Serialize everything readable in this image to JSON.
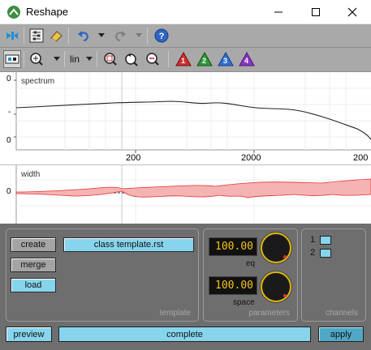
{
  "window": {
    "title": "Reshape"
  },
  "toolbar1": {
    "icons": [
      "pin-icon",
      "settings-icon",
      "eraser-icon",
      "undo-icon",
      "redo-icon",
      "help-icon"
    ]
  },
  "toolbar2": {
    "scale_value": "lin",
    "marker_labels": [
      "1",
      "2",
      "3",
      "4"
    ],
    "marker_colors": [
      "#d32f2f",
      "#2e9a3a",
      "#2f6fd6",
      "#8a35c8"
    ]
  },
  "spectrum": {
    "label": "spectrum",
    "y_ticks": [
      "0",
      "-",
      "0"
    ],
    "x_ticks": [
      "200",
      "2000",
      "200"
    ]
  },
  "width": {
    "label": "width",
    "y_tick": "0"
  },
  "template": {
    "group_label": "template",
    "buttons": {
      "create": "create",
      "merge": "merge",
      "load": "load"
    },
    "file_name": "class template.rst"
  },
  "parameters": {
    "group_label": "parameters",
    "eq": {
      "name": "eq",
      "value": "100.00"
    },
    "space": {
      "name": "space",
      "value": "100.00"
    }
  },
  "channels": {
    "group_label": "channels",
    "items": [
      "1",
      "2"
    ]
  },
  "footer": {
    "preview": "preview",
    "status": "complete",
    "apply": "apply"
  },
  "colors": {
    "toolbar": "#a9a9a9",
    "panel": "#6e6e6e",
    "button_cyan": "#86d5ec",
    "band_fill": "#f5b3b3",
    "band_stroke": "#e03030",
    "lcd_text": "#f5c31a"
  }
}
